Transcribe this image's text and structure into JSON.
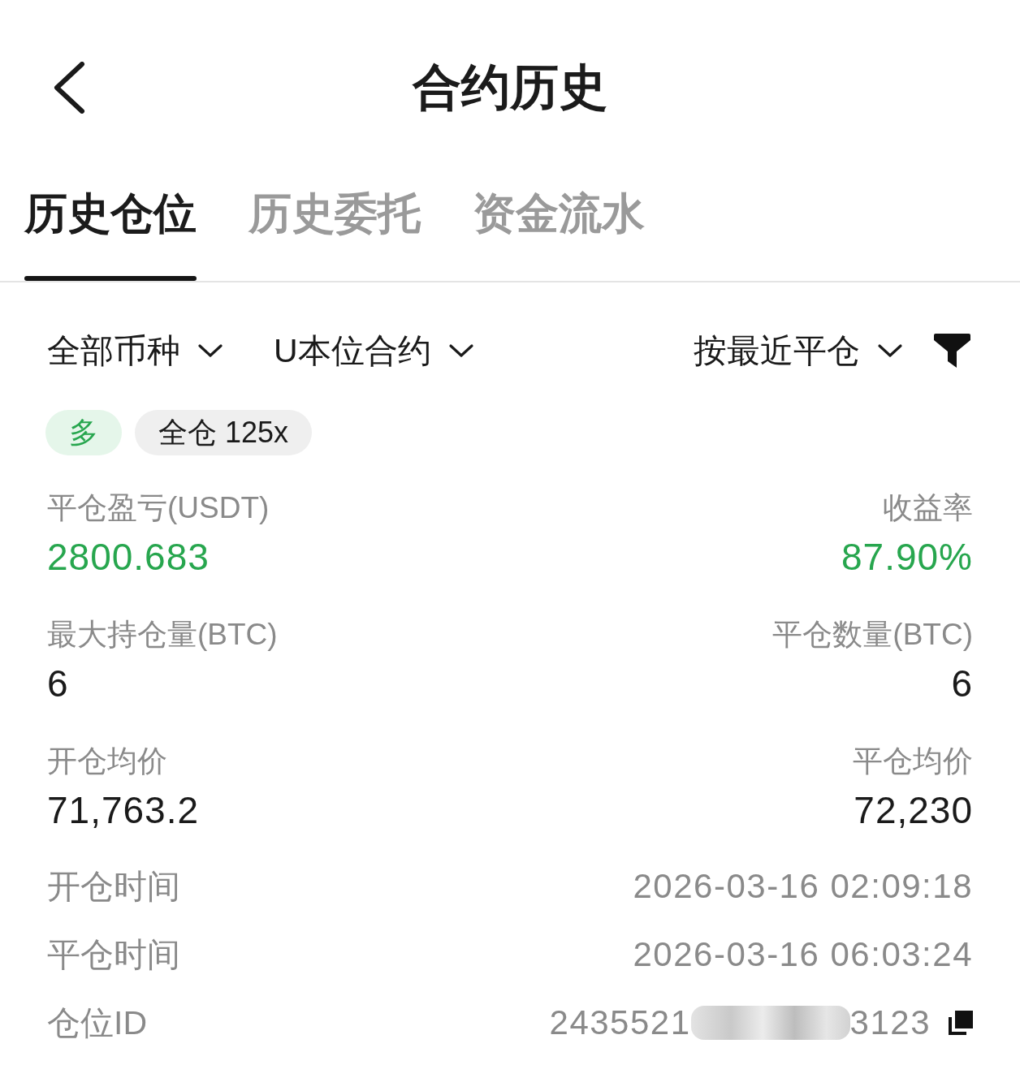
{
  "header": {
    "title": "合约历史"
  },
  "tabs": [
    {
      "label": "历史仓位",
      "selected": true
    },
    {
      "label": "历史委托",
      "selected": false
    },
    {
      "label": "资金流水",
      "selected": false
    }
  ],
  "filters": {
    "dropdowns": [
      {
        "label": "全部币种"
      },
      {
        "label": "U本位合约"
      }
    ],
    "sort": {
      "label": "按最近平仓"
    }
  },
  "position": {
    "tags": [
      {
        "kind": "side",
        "label": "多"
      },
      {
        "kind": "mode",
        "label": "全仓 125x"
      }
    ],
    "metrics": [
      {
        "label": "平仓盈亏(USDT)",
        "value": "2800.683",
        "positive": true
      },
      {
        "label": "收益率",
        "value": "87.90%",
        "positive": true
      },
      {
        "label": "最大持仓量(BTC)",
        "value": "6",
        "positive": false
      },
      {
        "label": "平仓数量(BTC)",
        "value": "6",
        "positive": false
      },
      {
        "label": "开仓均价",
        "value": "71,763.2",
        "positive": false
      },
      {
        "label": "平仓均价",
        "value": "72,230",
        "positive": false
      }
    ],
    "details": [
      {
        "kind": "text",
        "label": "开仓时间",
        "value": "2026-03-16 02:09:18"
      },
      {
        "kind": "text",
        "label": "平仓时间",
        "value": "2026-03-16 06:03:24"
      },
      {
        "kind": "masked_id",
        "label": "仓位ID",
        "value": "2435521",
        "value_tail": "3123"
      }
    ]
  }
}
